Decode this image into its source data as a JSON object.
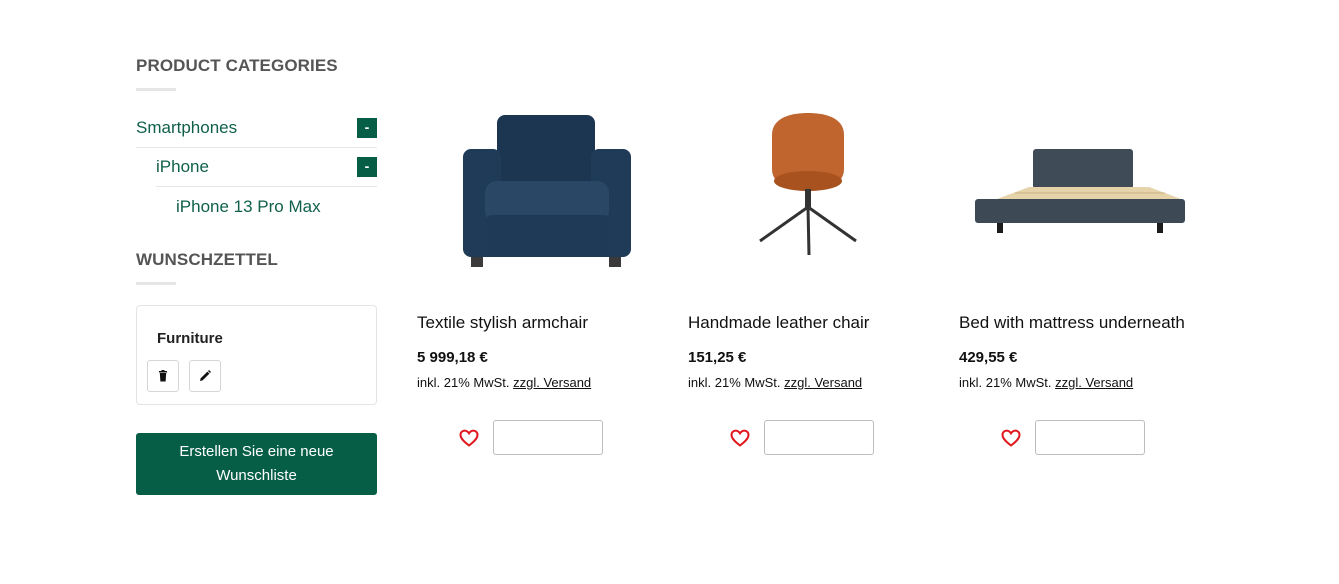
{
  "sidebar": {
    "categories_title": "PRODUCT CATEGORIES",
    "categories": [
      {
        "label": "Smartphones",
        "toggle": "-"
      },
      {
        "label": "iPhone",
        "toggle": "-"
      },
      {
        "label": "iPhone 13 Pro Max"
      }
    ],
    "wishlist_title": "WUNSCHZETTEL",
    "wishlist": {
      "name": "Furniture",
      "delete_icon": "trash-icon",
      "edit_icon": "pencil-icon"
    },
    "create_button": {
      "line1": "Erstellen Sie eine neue",
      "line2": "Wunschliste"
    }
  },
  "products": [
    {
      "name": "Textile stylish armchair",
      "price": "5 999,18 €",
      "tax": "inkl. 21% MwSt.",
      "shipping": "zzgl. Versand",
      "qty_value": ""
    },
    {
      "name": "Handmade leather chair",
      "price": "151,25 €",
      "tax": "inkl. 21% MwSt.",
      "shipping": "zzgl. Versand",
      "qty_value": ""
    },
    {
      "name": "Bed with mattress underneath",
      "price": "429,55 €",
      "tax": "inkl. 21% MwSt.",
      "shipping": "zzgl. Versand",
      "qty_value": ""
    }
  ],
  "colors": {
    "brand_green": "#075e46",
    "link_green": "#0f5f4a",
    "heart_red": "#e0181e"
  }
}
